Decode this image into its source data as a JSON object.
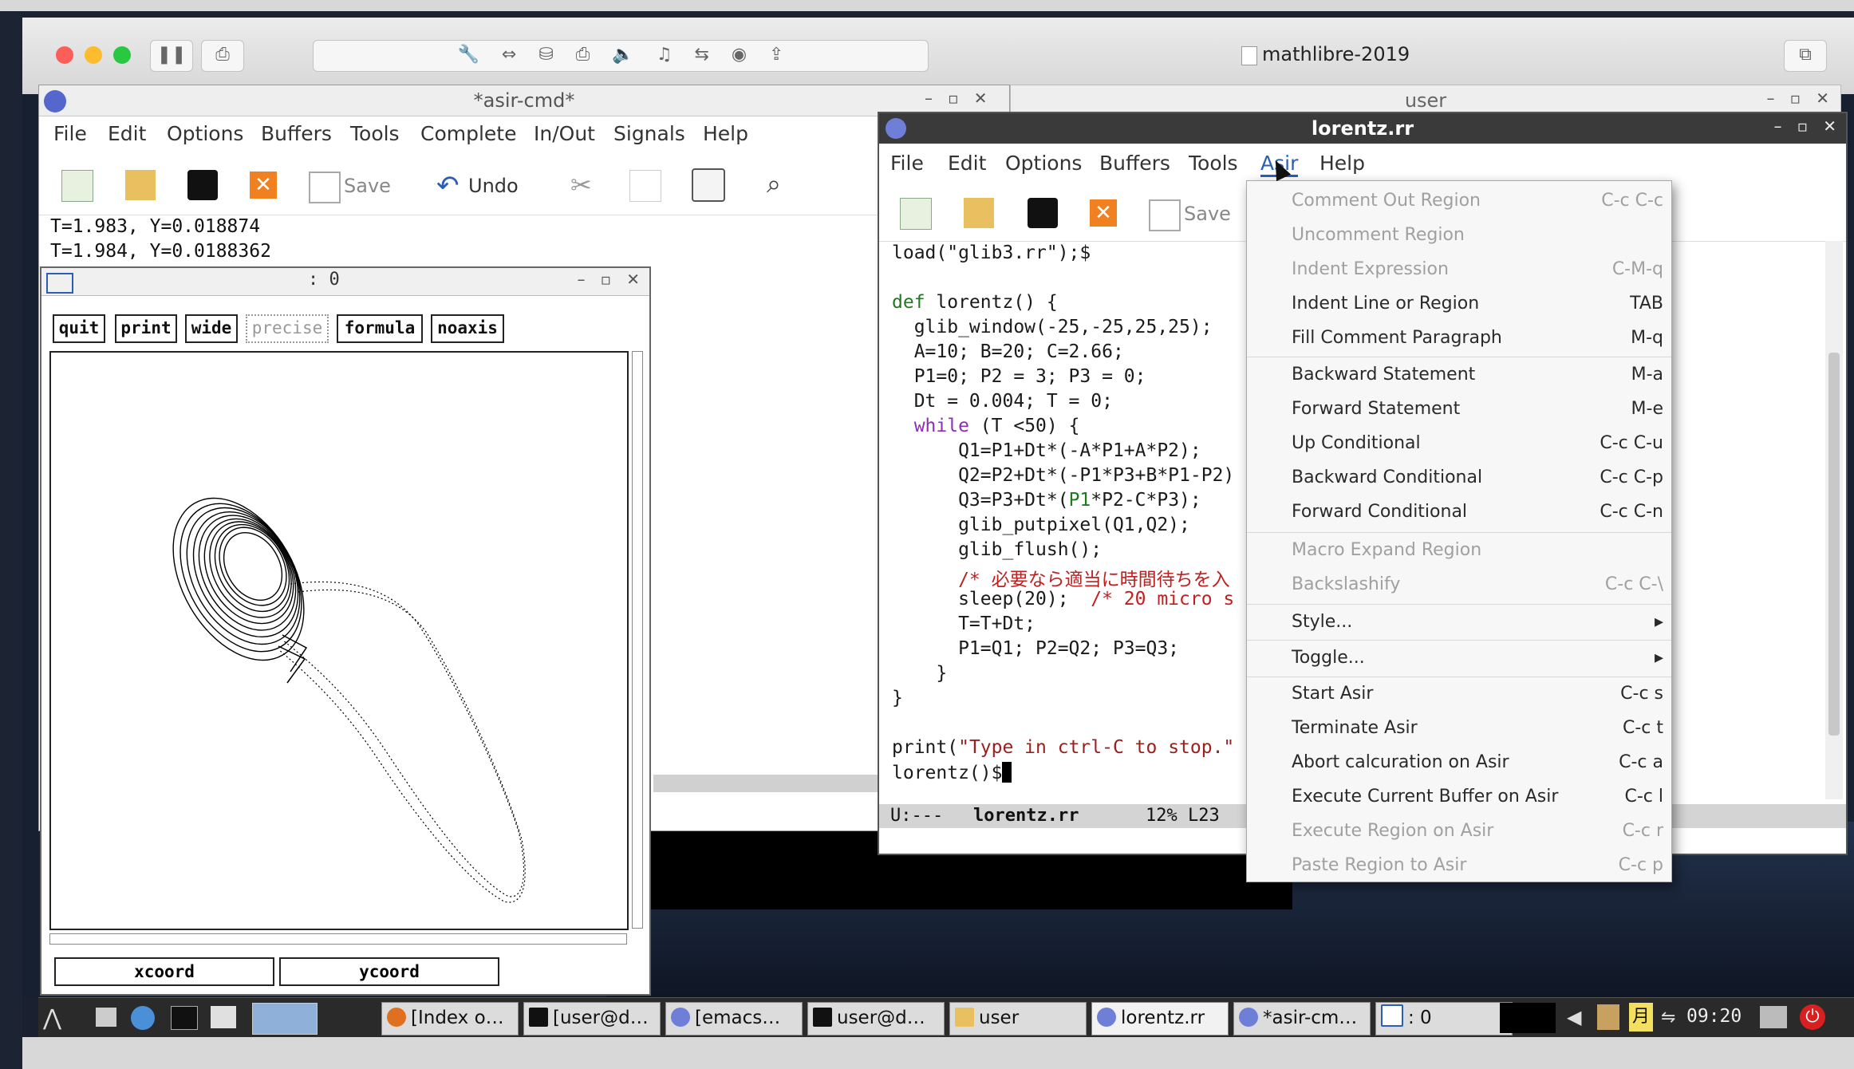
{
  "vmware": {
    "title": "mathlibre-2019"
  },
  "asir_cmd": {
    "title": "*asir-cmd*",
    "menu": [
      "File",
      "Edit",
      "Options",
      "Buffers",
      "Tools",
      "Complete",
      "In/Out",
      "Signals",
      "Help"
    ],
    "toolbar": {
      "save_label": "Save",
      "undo_label": "Undo"
    },
    "output": [
      "T=1.983, Y=0.018874",
      "T=1.984, Y=0.0188362"
    ]
  },
  "user_window": {
    "title": "user"
  },
  "glib": {
    "title": ": 0",
    "buttons": [
      "quit",
      "print",
      "wide",
      "precise",
      "formula",
      "noaxis"
    ],
    "coord_fields": [
      "xcoord",
      "ycoord"
    ]
  },
  "editor": {
    "title": "lorentz.rr",
    "menu": [
      "File",
      "Edit",
      "Options",
      "Buffers",
      "Tools",
      "Asir",
      "Help"
    ],
    "toolbar": {
      "save_label": "Save"
    },
    "code": {
      "l1": "load(\"glib3.rr\");$",
      "l2_kw": "def",
      "l2_rest": " lorentz() {",
      "l3": "  glib_window(-25,-25,25,25);",
      "l4": "  A=10; B=20; C=2.66;",
      "l5": "  P1=0; P2 = 3; P3 = 0;",
      "l6": "  Dt = 0.004; T = 0;",
      "l7_kw": "while",
      "l7_rest": " (T <50) {",
      "l8": "      Q1=P1+Dt*(-A*P1+A*P2);",
      "l9": "      Q2=P2+Dt*(-P1*P3+B*P1-P2)",
      "l10a": "      Q3=P3+Dt*(",
      "l10b": "P1",
      "l10c": "*P2-C*P3);",
      "l11": "      glib_putpixel(Q1,Q2);",
      "l12": "      glib_flush();",
      "l13": "      /* 必要なら適当に時間待ちを入",
      "l14a": "      sleep(20);  ",
      "l14b": "/* 20 micro s",
      "l15": "      T=T+Dt;",
      "l16": "      P1=Q1; P2=Q2; P3=Q3;",
      "l17": "    }",
      "l18": "}",
      "l19a": "print(",
      "l19b": "\"Type in ctrl-C to stop.\"",
      "l20": "lorentz()$"
    },
    "modeline": {
      "status": "U:---",
      "buffer": "lorentz.rr",
      "position": "12% L23"
    }
  },
  "asir_menu": {
    "items": [
      {
        "label": "Comment Out Region",
        "key": "C-c C-c",
        "enabled": false
      },
      {
        "label": "Uncomment Region",
        "key": "",
        "enabled": false
      },
      {
        "label": "Indent Expression",
        "key": "C-M-q",
        "enabled": false
      },
      {
        "label": "Indent Line or Region",
        "key": "TAB",
        "enabled": true
      },
      {
        "label": "Fill Comment Paragraph",
        "key": "M-q",
        "enabled": true
      },
      {
        "label": "Backward Statement",
        "key": "M-a",
        "enabled": true
      },
      {
        "label": "Forward Statement",
        "key": "M-e",
        "enabled": true
      },
      {
        "label": "Up Conditional",
        "key": "C-c C-u",
        "enabled": true
      },
      {
        "label": "Backward Conditional",
        "key": "C-c C-p",
        "enabled": true
      },
      {
        "label": "Forward Conditional",
        "key": "C-c C-n",
        "enabled": true
      },
      {
        "label": "Macro Expand Region",
        "key": "",
        "enabled": false
      },
      {
        "label": "Backslashify",
        "key": "C-c C-\\",
        "enabled": false
      },
      {
        "label": "Style...",
        "key": "▸",
        "enabled": true
      },
      {
        "label": "Toggle...",
        "key": "▸",
        "enabled": true
      },
      {
        "label": "Start Asir",
        "key": "C-c s",
        "enabled": true
      },
      {
        "label": "Terminate Asir",
        "key": "C-c t",
        "enabled": true
      },
      {
        "label": "Abort calcuration on Asir",
        "key": "C-c a",
        "enabled": true
      },
      {
        "label": "Execute Current Buffer on Asir",
        "key": "C-c l",
        "enabled": true
      },
      {
        "label": "Execute Region on Asir",
        "key": "C-c r",
        "enabled": false
      },
      {
        "label": "Paste Region to Asir",
        "key": "C-c p",
        "enabled": false
      }
    ]
  },
  "taskbar": {
    "items": [
      "[Index o…",
      "[user@d…",
      "[emacs…",
      "user@d…",
      "user",
      "lorentz.rr",
      "*asir-cm…",
      ": 0"
    ],
    "clock": "09:20",
    "ime": "月"
  }
}
